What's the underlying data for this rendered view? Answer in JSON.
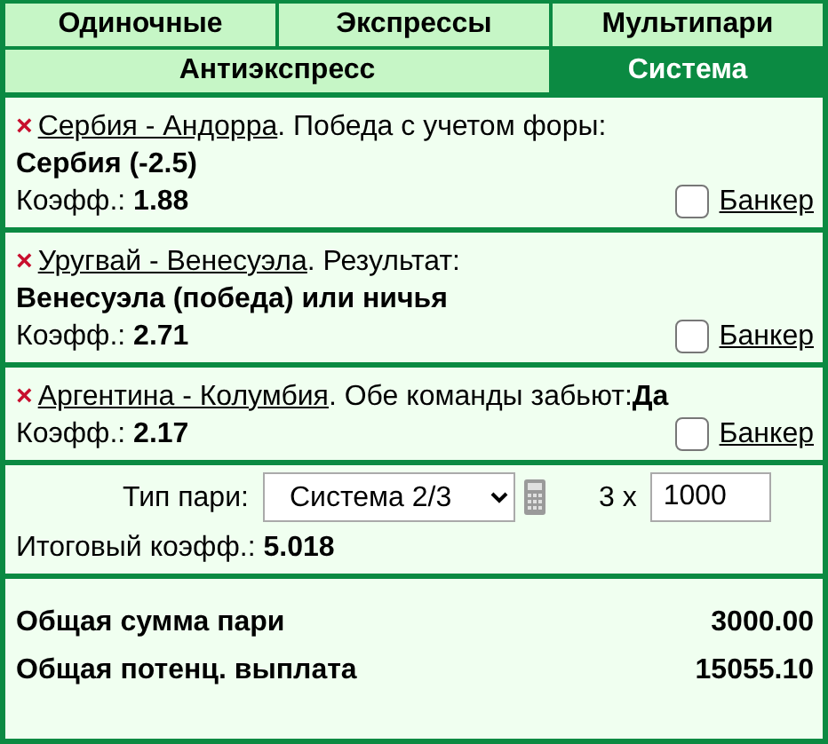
{
  "tab_rows": [
    [
      {
        "label": "Одиночные",
        "selected": false
      },
      {
        "label": "Экспрессы",
        "selected": false
      },
      {
        "label": "Мультипари",
        "selected": false
      }
    ],
    [
      {
        "label": "Антиэкспресс",
        "selected": false
      },
      {
        "label": "Система",
        "selected": true
      }
    ]
  ],
  "bets": [
    {
      "remove": "×",
      "match": "Сербия - Андорра",
      "market": ". Победа с учетом форы:",
      "selection": "Сербия (-2.5)",
      "kind": "block",
      "odds_label": "Коэфф.:",
      "odds": "1.88",
      "banker_checked": false,
      "banker_label": "Банкер"
    },
    {
      "remove": "×",
      "match": "Уругвай - Венесуэла",
      "market": ". Результат:",
      "selection": "Венесуэла (победа) или ничья",
      "kind": "block",
      "odds_label": "Коэфф.:",
      "odds": "2.71",
      "banker_checked": false,
      "banker_label": "Банкер"
    },
    {
      "remove": "×",
      "match": "Аргентина - Колумбия",
      "market": ". Обе команды забьют:",
      "selection": "Да",
      "kind": "inline",
      "odds_label": "Коэфф.:",
      "odds": "2.17",
      "banker_checked": false,
      "banker_label": "Банкер"
    }
  ],
  "bet_type": {
    "label": "Тип пари:",
    "value": "Система 2/3",
    "multiplier": "3 x",
    "stake": "1000"
  },
  "total_odds": {
    "label": "Итоговый коэфф.:",
    "value": "5.018"
  },
  "totals": [
    {
      "label": "Общая сумма пари",
      "value": "3000.00"
    },
    {
      "label": "Общая потенц. выплата",
      "value": "15055.10"
    }
  ]
}
